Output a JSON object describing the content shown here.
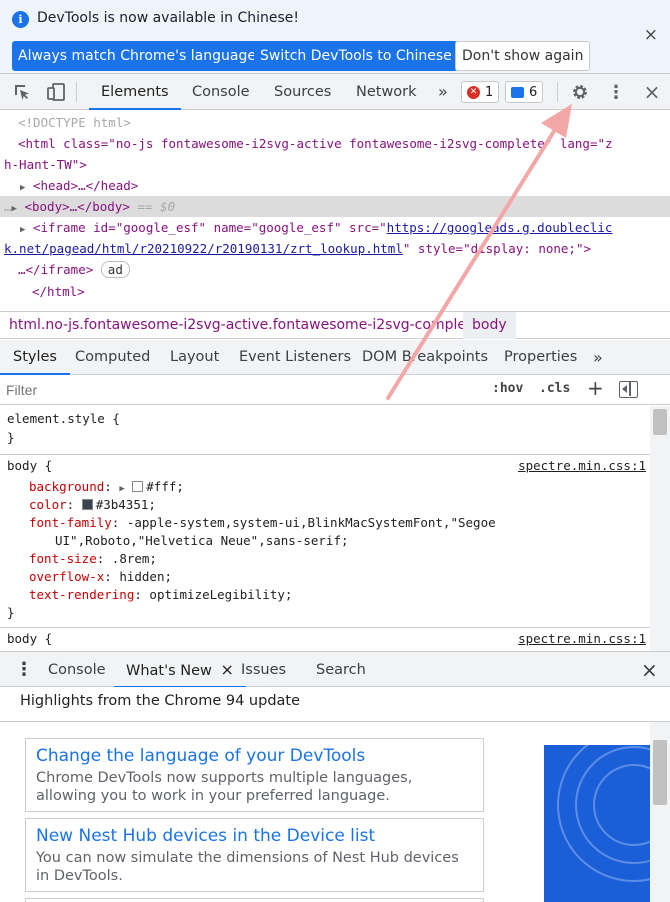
{
  "infobar": {
    "message": "DevTools is now available in Chinese!",
    "btn_match": "Always match Chrome's language",
    "btn_switch": "Switch DevTools to Chinese",
    "btn_dont_show": "Don't show again",
    "close": "×"
  },
  "toolbar": {
    "tabs": [
      "Elements",
      "Console",
      "Sources",
      "Network"
    ],
    "more": "»",
    "errors_count": "1",
    "messages_count": "6",
    "kebab": "⋮",
    "close": "×"
  },
  "dom": {
    "doctype": "<!DOCTYPE html>",
    "html_open_1": "<html class=\"no-js fontawesome-i2svg-active fontawesome-i2svg-complete\" lang=\"z",
    "html_open_2": "h-Hant-TW\">",
    "head": "<head>…</head>",
    "body": "<body>…</body>",
    "body_marker": "== $0",
    "body_dots": "…",
    "iframe_1_pre": "<iframe id=\"google_esf\" name=\"google_esf\" src=\"",
    "iframe_1_link": "https://googleads.g.doubleclic",
    "iframe_2_link": "k.net/pagead/html/r20210922/r20190131/zrt_lookup.html",
    "iframe_2_post": "\" style=\"display: none;\">",
    "iframe_3": "…</iframe>",
    "ad_badge": "ad",
    "html_close": "</html>"
  },
  "breadcrumbs": [
    "html.no-js.fontawesome-i2svg-active.fontawesome-i2svg-complete",
    "body"
  ],
  "style_tabs": [
    "Styles",
    "Computed",
    "Layout",
    "Event Listeners",
    "DOM Breakpoints",
    "Properties"
  ],
  "style_more": "»",
  "filter": {
    "placeholder": "Filter",
    "hov": ":hov",
    "cls": ".cls",
    "plus": "+"
  },
  "styles": {
    "element_style": "element.style {",
    "close_brace": "}",
    "rule1_selector": "body {",
    "rule1_source": "spectre.min.css:1",
    "rule1_props": [
      {
        "name": "background",
        "value": "#fff"
      },
      {
        "name": "color",
        "value": "#3b4351"
      },
      {
        "name": "font-family",
        "value": "-apple-system,system-ui,BlinkMacSystemFont,\"Segoe"
      },
      {
        "name": "",
        "value": "UI\",Roboto,\"Helvetica Neue\",sans-serif;"
      },
      {
        "name": "font-size",
        "value": ".8rem;"
      },
      {
        "name": "overflow-x",
        "value": "hidden;"
      },
      {
        "name": "text-rendering",
        "value": "optimizeLegibility;"
      }
    ],
    "rule2_selector": "body {",
    "rule2_source": "spectre.min.css:1",
    "swatch_colors": [
      "#ffffff",
      "#3b4351"
    ]
  },
  "drawer": {
    "tabs": [
      "Console",
      "What's New",
      "Issues",
      "Search"
    ],
    "whats_new_close": "×",
    "close": "×",
    "highlights": "Highlights from the Chrome 94 update",
    "cards": [
      {
        "title": "Change the language of your DevTools",
        "desc": "Chrome DevTools now supports multiple languages, allowing you to work in your preferred language."
      },
      {
        "title": "New Nest Hub devices in the Device list",
        "desc": "You can now simulate the dimensions of Nest Hub devices in DevTools."
      }
    ]
  },
  "colors": {
    "accent": "#1a73e8",
    "arrow": "#f4a7a7",
    "error": "#d93025"
  }
}
